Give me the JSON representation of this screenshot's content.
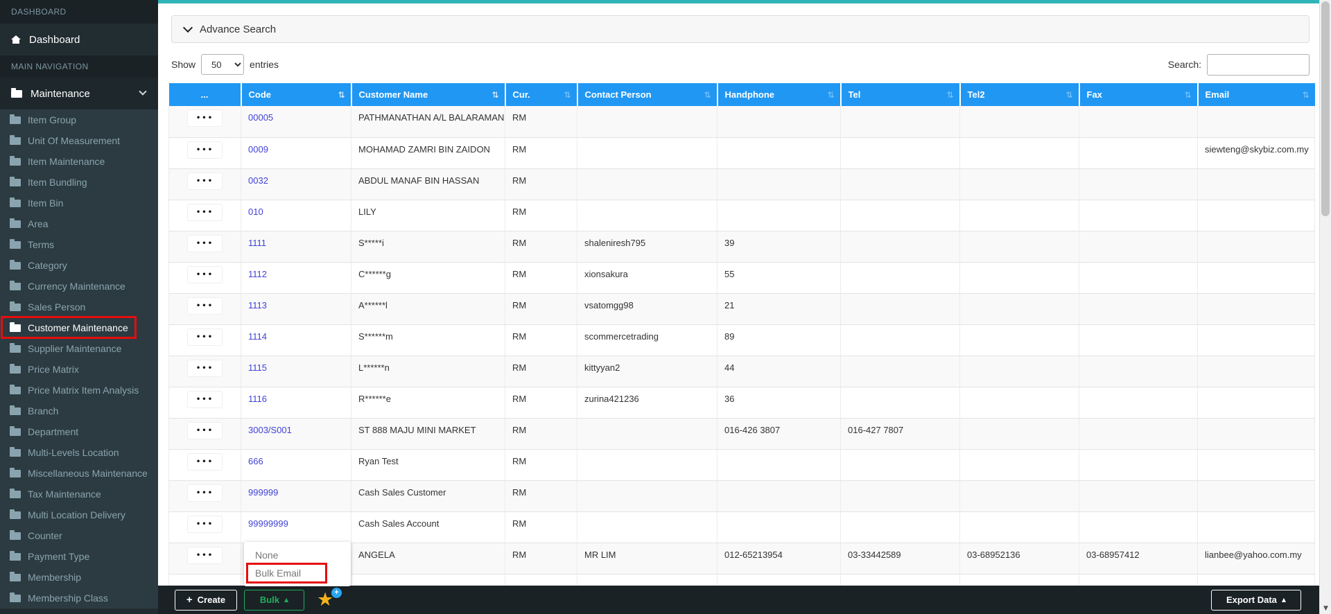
{
  "icons": {
    "sort": "⇅",
    "ellipsis": "•••",
    "caret_up": "▲",
    "caret_down": "▼",
    "star": "★",
    "plus": "+",
    "badge_plus": "+"
  },
  "colors": {
    "header_blue": "#2097f3",
    "teal_top": "#30b5ba",
    "sidebar_bg": "#222d32",
    "sidebar_dark": "#1a2226",
    "sidebar_active": "#1e282c",
    "submenu_bg": "#2c3b41",
    "submenu_text": "#8aa4af",
    "green": "#21ae5c",
    "link_blue": "#4141d9",
    "annotation_red": "#e60d0d",
    "gold": "#f2b21c",
    "badge_blue": "#29a8f0",
    "footer_bg": "#1a2226"
  },
  "sidebar": {
    "section_dashboard": "DASHBOARD",
    "dashboard_item": "Dashboard",
    "section_main": "MAIN NAVIGATION",
    "maintenance_item": "Maintenance",
    "items": [
      {
        "label": "Item Group"
      },
      {
        "label": "Unit Of Measurement"
      },
      {
        "label": "Item Maintenance"
      },
      {
        "label": "Item Bundling"
      },
      {
        "label": "Item Bin"
      },
      {
        "label": "Area"
      },
      {
        "label": "Terms"
      },
      {
        "label": "Category"
      },
      {
        "label": "Currency Maintenance"
      },
      {
        "label": "Sales Person"
      },
      {
        "label": "Customer Maintenance",
        "active": true,
        "annotated": true
      },
      {
        "label": "Supplier Maintenance"
      },
      {
        "label": "Price Matrix"
      },
      {
        "label": "Price Matrix Item Analysis"
      },
      {
        "label": "Branch"
      },
      {
        "label": "Department"
      },
      {
        "label": "Multi-Levels Location"
      },
      {
        "label": "Miscellaneous Maintenance"
      },
      {
        "label": "Tax Maintenance"
      },
      {
        "label": "Multi Location Delivery"
      },
      {
        "label": "Counter"
      },
      {
        "label": "Payment Type"
      },
      {
        "label": "Membership"
      },
      {
        "label": "Membership Class"
      }
    ]
  },
  "advance_search": {
    "label": "Advance Search"
  },
  "toolbar": {
    "show_label": "Show",
    "page_size": "50",
    "entries_label": "entries",
    "search_label": "Search:",
    "search_value": ""
  },
  "table": {
    "columns": [
      {
        "label": "...",
        "sort": "none"
      },
      {
        "label": "Code",
        "sort": "active"
      },
      {
        "label": "Customer Name",
        "sort": "active"
      },
      {
        "label": "Cur.",
        "sort": "default"
      },
      {
        "label": "Contact Person",
        "sort": "default"
      },
      {
        "label": "Handphone",
        "sort": "default"
      },
      {
        "label": "Tel",
        "sort": "default"
      },
      {
        "label": "Tel2",
        "sort": "default"
      },
      {
        "label": "Fax",
        "sort": "default"
      },
      {
        "label": "Email",
        "sort": "default"
      }
    ],
    "rows": [
      {
        "code": "00005",
        "name": "PATHMANATHAN A/L BALARAMAN",
        "cur": "RM",
        "contact": "",
        "handphone": "",
        "tel": "",
        "tel2": "",
        "fax": "",
        "email": ""
      },
      {
        "code": "0009",
        "name": "MOHAMAD ZAMRI BIN ZAIDON",
        "cur": "RM",
        "contact": "",
        "handphone": "",
        "tel": "",
        "tel2": "",
        "fax": "",
        "email": "siewteng@skybiz.com.my"
      },
      {
        "code": "0032",
        "name": "ABDUL MANAF BIN HASSAN",
        "cur": "RM",
        "contact": "",
        "handphone": "",
        "tel": "",
        "tel2": "",
        "fax": "",
        "email": ""
      },
      {
        "code": "010",
        "name": "LILY",
        "cur": "RM",
        "contact": "",
        "handphone": "",
        "tel": "",
        "tel2": "",
        "fax": "",
        "email": ""
      },
      {
        "code": "1111",
        "name": "S*****i",
        "cur": "RM",
        "contact": "shaleniresh795",
        "handphone": "39",
        "tel": "",
        "tel2": "",
        "fax": "",
        "email": ""
      },
      {
        "code": "1112",
        "name": "C******g",
        "cur": "RM",
        "contact": "xionsakura",
        "handphone": "55",
        "tel": "",
        "tel2": "",
        "fax": "",
        "email": ""
      },
      {
        "code": "1113",
        "name": "A******l",
        "cur": "RM",
        "contact": "vsatomgg98",
        "handphone": "21",
        "tel": "",
        "tel2": "",
        "fax": "",
        "email": ""
      },
      {
        "code": "1114",
        "name": "S******m",
        "cur": "RM",
        "contact": "scommercetrading",
        "handphone": "89",
        "tel": "",
        "tel2": "",
        "fax": "",
        "email": ""
      },
      {
        "code": "1115",
        "name": "L******n",
        "cur": "RM",
        "contact": "kittyyan2",
        "handphone": "44",
        "tel": "",
        "tel2": "",
        "fax": "",
        "email": ""
      },
      {
        "code": "1116",
        "name": "R******e",
        "cur": "RM",
        "contact": "zurina421236",
        "handphone": "36",
        "tel": "",
        "tel2": "",
        "fax": "",
        "email": ""
      },
      {
        "code": "3003/S001",
        "name": "ST 888 MAJU MINI MARKET",
        "cur": "RM",
        "contact": "",
        "handphone": "016-426 3807",
        "tel": "016-427 7807",
        "tel2": "",
        "fax": "",
        "email": ""
      },
      {
        "code": "666",
        "name": "Ryan Test",
        "cur": "RM",
        "contact": "",
        "handphone": "",
        "tel": "",
        "tel2": "",
        "fax": "",
        "email": ""
      },
      {
        "code": "999999",
        "name": "Cash Sales Customer",
        "cur": "RM",
        "contact": "",
        "handphone": "",
        "tel": "",
        "tel2": "",
        "fax": "",
        "email": ""
      },
      {
        "code": "99999999",
        "name": "Cash Sales Account",
        "cur": "RM",
        "contact": "",
        "handphone": "",
        "tel": "",
        "tel2": "",
        "fax": "",
        "email": ""
      },
      {
        "code": "",
        "name": "ANGELA",
        "cur": "RM",
        "contact": "MR LIM",
        "handphone": "012-65213954",
        "tel": "03-33442589",
        "tel2": "03-68952136",
        "fax": "03-68957412",
        "email": "lianbee@yahoo.com.my"
      }
    ]
  },
  "bulk_menu": {
    "items": [
      {
        "label": "None"
      },
      {
        "label": "Bulk Email",
        "annotated": true
      }
    ]
  },
  "footer": {
    "create_label": "Create",
    "bulk_label": "Bulk",
    "export_label": "Export Data"
  }
}
